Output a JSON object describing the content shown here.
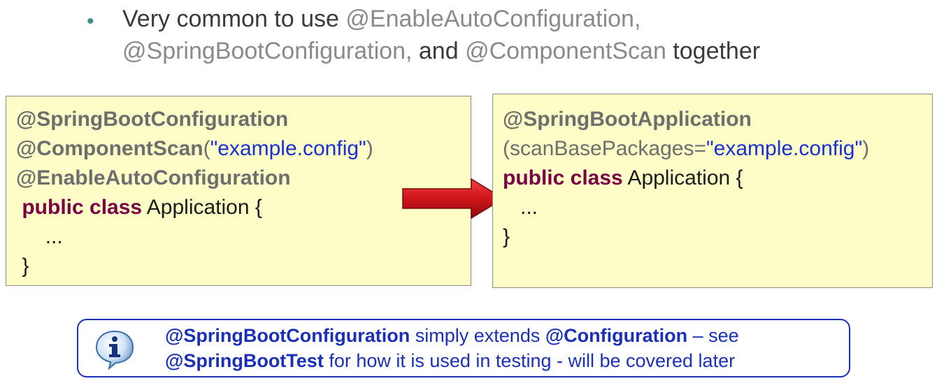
{
  "bullet": {
    "marker": "•",
    "line1": {
      "t1": "Very common to use ",
      "t2": "@EnableAutoConfiguration,"
    },
    "line2": {
      "t1": "@SpringBootConfiguration,",
      "t2": "  and ",
      "t3": "@ComponentScan",
      "t4": " together"
    }
  },
  "left_code": {
    "l1": "@SpringBootConfiguration",
    "l2_anno": "@ComponentScan",
    "l2_open": "(",
    "l2_str": "\"example.config\"",
    "l2_close": ")",
    "l3": "@EnableAutoConfiguration",
    "l4_kw": "public class",
    "l4_rest": " Application {",
    "l5": "...",
    "l6": "}"
  },
  "right_code": {
    "l1": "@SpringBootApplication",
    "l2_a": "(scanBasePackages=",
    "l2_str": "\"example.config\"",
    "l2_close": ")",
    "l3_kw": "public class",
    "l3_rest": " Application {",
    "l4": "...",
    "l5": "}"
  },
  "arrow": {
    "color": "#d0141a"
  },
  "info": {
    "icon": "info-icon",
    "line1": {
      "b1": "@SpringBootConfiguration",
      "t1": " simply extends ",
      "b2": "@Configuration",
      "t2": " – see"
    },
    "line2": {
      "b1": "@SpringBootTest",
      "t1": " for how it is used in testing - will be covered later"
    }
  },
  "colors": {
    "code_bg": "#fdfdc8",
    "keyword": "#7a0046",
    "string": "#1a2fd4",
    "annotation": "#6e6e6e",
    "info_border": "#1c2fb8",
    "bullet_marker": "#3f8f8a"
  }
}
